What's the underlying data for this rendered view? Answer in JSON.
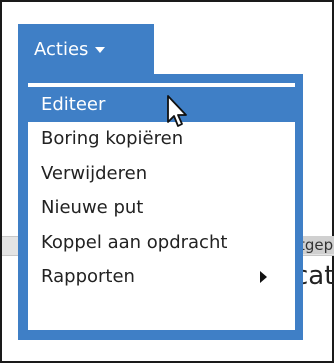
{
  "background": {
    "tab_text": "tgep",
    "label_text": "cat"
  },
  "actions_menu": {
    "button_label": "Acties",
    "items": [
      {
        "label": "Editeer",
        "selected": true
      },
      {
        "label": "Boring kopiëren"
      },
      {
        "label": "Verwijderen"
      },
      {
        "label": "Nieuwe put"
      },
      {
        "label": "Koppel aan opdracht"
      },
      {
        "label": "Rapporten",
        "has_submenu": true
      }
    ]
  },
  "colors": {
    "accent": "#3f7fc6",
    "menu_background": "#ffffff",
    "text": "#222222"
  },
  "icons": {
    "button_caret": "caret-down-icon",
    "submenu_arrow": "caret-right-icon",
    "pointer": "mouse-cursor-icon"
  }
}
